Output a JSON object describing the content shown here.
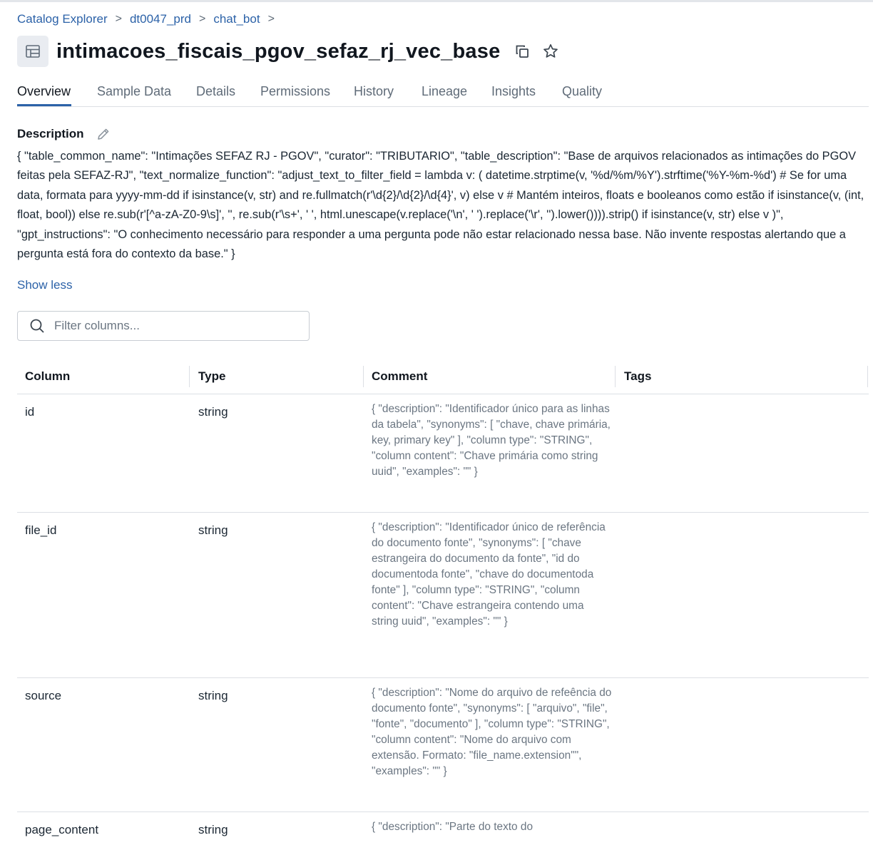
{
  "breadcrumb": {
    "items": [
      "Catalog Explorer",
      "dt0047_prd",
      "chat_bot"
    ],
    "separator": ">"
  },
  "header": {
    "title": "intimacoes_fiscais_pgov_sefaz_rj_vec_base",
    "icons": [
      "table-icon",
      "copy-icon",
      "star-icon"
    ]
  },
  "tabs": [
    "Overview",
    "Sample Data",
    "Details",
    "Permissions",
    "History",
    "Lineage",
    "Insights",
    "Quality"
  ],
  "active_tab": "Overview",
  "description": {
    "label": "Description",
    "text": "{ \"table_common_name\": \"Intimações SEFAZ RJ - PGOV\", \"curator\": \"TRIBUTARIO\", \"table_description\": \"Base de arquivos relacionados as intimações do PGOV feitas pela SEFAZ-RJ\", \"text_normalize_function\": \"adjust_text_to_filter_field = lambda v: ( datetime.strptime(v, '%d/%m/%Y').strftime('%Y-%m-%d') # Se for uma data, formata para yyyy-mm-dd if isinstance(v, str) and re.fullmatch(r'\\d{2}/\\d{2}/\\d{4}', v) else v # Mantém inteiros, floats e booleanos como estão if isinstance(v, (int, float, bool)) else re.sub(r'[^a-zA-Z0-9\\s]', '', re.sub(r'\\s+', ' ', html.unescape(v.replace('\\n', ' ').replace('\\r', '').lower()))).strip() if isinstance(v, str) else v )\", \"gpt_instructions\": \"O conhecimento necessário para responder a uma pergunta pode não estar relacionado nessa base. Não invente respostas alertando que a pergunta está fora do contexto da base.\" }",
    "toggle_label": "Show less"
  },
  "filter": {
    "placeholder": "Filter columns...",
    "value": ""
  },
  "table": {
    "headers": [
      "Column",
      "Type",
      "Comment",
      "Tags"
    ],
    "rows": [
      {
        "name": "id",
        "type": "string",
        "comment": "{ \"description\": \"Identificador único para as linhas da tabela\", \"synonyms\": [ \"chave, chave primária, key, primary key\" ], \"column type\": \"STRING\", \"column content\": \"Chave primária como string uuid\", \"examples\": \"\" }",
        "tags": ""
      },
      {
        "name": "file_id",
        "type": "string",
        "comment": "{ \"description\": \"Identificador único de referência do documento fonte\", \"synonyms\": [ \"chave estrangeira do documento da fonte\", \"id do documentoda fonte\", \"chave do documentoda fonte\" ], \"column type\": \"STRING\", \"column content\": \"Chave estrangeira contendo uma string uuid\", \"examples\": \"\" }",
        "tags": ""
      },
      {
        "name": "source",
        "type": "string",
        "comment": "{ \"description\": \"Nome do arquivo de refeência do documento fonte\", \"synonyms\": [ \"arquivo\", \"file\", \"fonte\", \"documento\" ], \"column type\": \"STRING\", \"column content\": \"Nome do arquivo com extensão. Formato: \"file_name.extension\"\", \"examples\": \"\" }",
        "tags": ""
      },
      {
        "name": "page_content",
        "type": "string",
        "comment": "{ \"description\": \"Parte do texto do",
        "tags": ""
      }
    ]
  }
}
